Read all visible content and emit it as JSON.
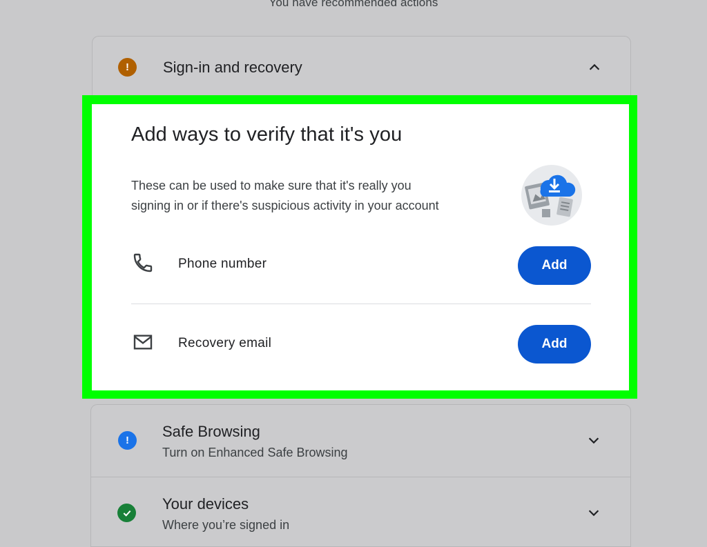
{
  "header": {
    "recommended_text": "You have recommended actions"
  },
  "signin_card": {
    "title": "Sign-in and recovery",
    "status_icon": "warning-icon",
    "status_color": "#b06000",
    "expanded": true
  },
  "verify_panel": {
    "title": "Add ways to verify that it's you",
    "description_line1": "These can be used to make sure that it's really you",
    "description_line2": "signing in or if there's suspicious activity in your account",
    "illustration": "cloud-download-illustration",
    "rows": [
      {
        "icon": "phone-icon",
        "label": "Phone number",
        "button": "Add"
      },
      {
        "icon": "mail-icon",
        "label": "Recovery email",
        "button": "Add"
      }
    ],
    "button_color": "#0b57d0"
  },
  "safe_browsing_card": {
    "title": "Safe Browsing",
    "subtitle": "Turn on Enhanced Safe Browsing",
    "status_icon": "info-icon",
    "status_color": "#1a73e8"
  },
  "devices_card": {
    "title": "Your devices",
    "subtitle": "Where you’re signed in",
    "status_icon": "check-icon",
    "status_color": "#188038"
  },
  "highlight_color": "#00ff00"
}
